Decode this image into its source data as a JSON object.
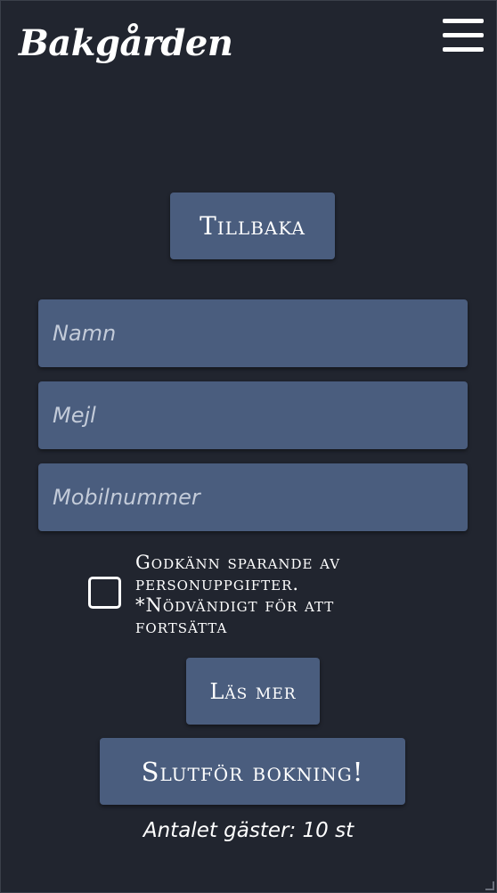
{
  "header": {
    "logo": "Bakgården",
    "menu_icon": "hamburger-menu-icon"
  },
  "buttons": {
    "back": "Tillbaka",
    "read_more": "Läs mer",
    "finish": "Slutför bokning!"
  },
  "form": {
    "name_placeholder": "Namn",
    "email_placeholder": "Mejl",
    "mobile_placeholder": "Mobilnummer",
    "consent_text": "Godkänn sparande av personuppgifter. *Nödvändigt för att fortsätta",
    "consent_checked": false
  },
  "summary": {
    "guests_text": "Antalet gäster: 10 st"
  },
  "colors": {
    "background": "#21252f",
    "button": "#4a5d7e",
    "text": "#ffffff",
    "placeholder": "#c3cbd9"
  }
}
